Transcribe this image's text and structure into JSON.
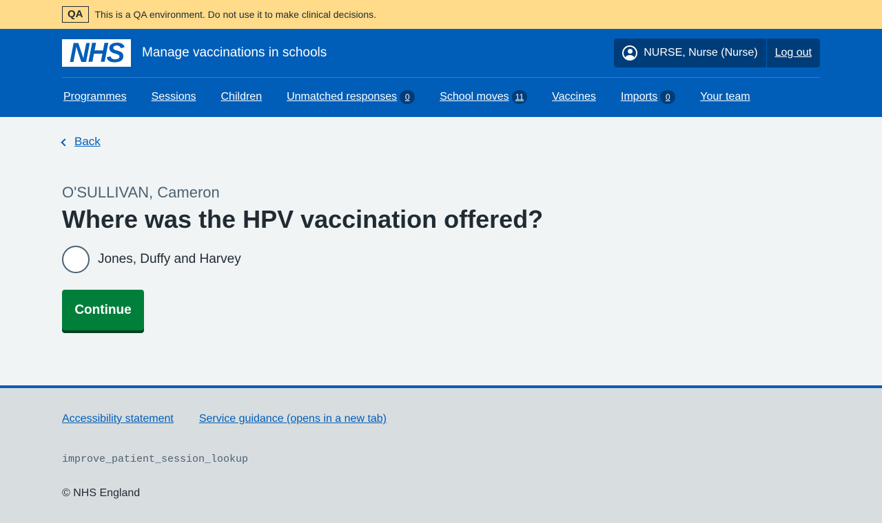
{
  "env_banner": {
    "tag": "QA",
    "message": "This is a QA environment. Do not use it to make clinical decisions."
  },
  "header": {
    "logo": "NHS",
    "service_name": "Manage vaccinations in schools",
    "user": "NURSE, Nurse (Nurse)",
    "logout": "Log out"
  },
  "nav": {
    "programmes": "Programmes",
    "sessions": "Sessions",
    "children": "Children",
    "unmatched": "Unmatched responses",
    "unmatched_count": "0",
    "school_moves": "School moves",
    "school_moves_count": "11",
    "vaccines": "Vaccines",
    "imports": "Imports",
    "imports_count": "0",
    "your_team": "Your team"
  },
  "main": {
    "back": "Back",
    "caption": "O'SULLIVAN, Cameron",
    "heading": "Where was the HPV vaccination offered?",
    "option": "Jones, Duffy and Harvey",
    "continue": "Continue"
  },
  "footer": {
    "accessibility": "Accessibility statement",
    "guidance": "Service guidance (opens in a new tab)",
    "build_tag": "improve_patient_session_lookup",
    "copyright": "© NHS England"
  },
  "colors": {
    "primary": "#005eb8",
    "button": "#007f3b",
    "banner": "#ffdb8a"
  }
}
